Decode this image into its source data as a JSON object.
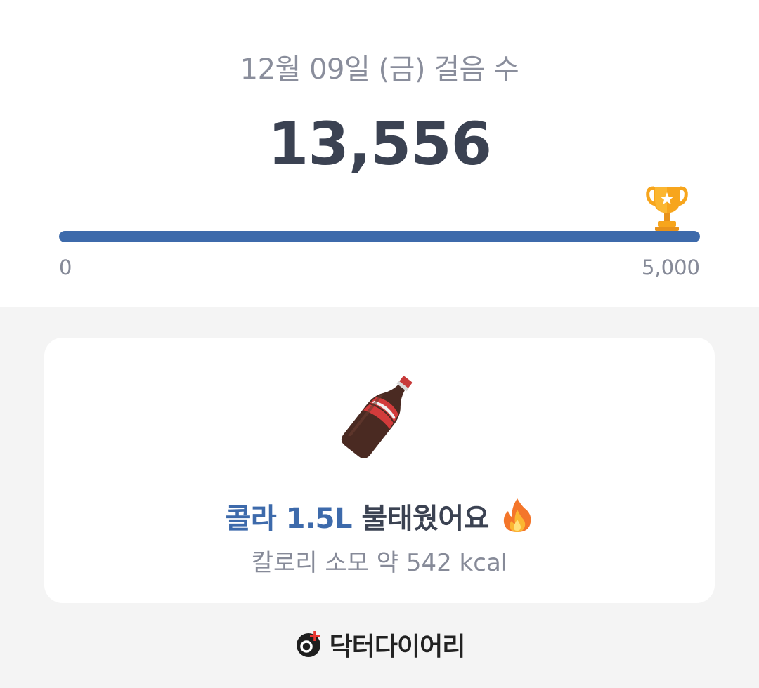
{
  "header": {
    "date_label": "12월 09일 (금) 걸음 수",
    "step_count": "13,556"
  },
  "progress": {
    "min_label": "0",
    "max_label": "5,000",
    "fill_fraction": 1.0,
    "goal_icon": "trophy-icon"
  },
  "card": {
    "item_icon": "cola-bottle-icon",
    "food_text": "콜라 1.5L",
    "burn_text": " 불태웠어요",
    "burn_icon": "fire-icon",
    "kcal_text": "칼로리 소모 약 542 kcal"
  },
  "footer": {
    "brand_name": "닥터다이어리",
    "brand_icon": "doctor-diary-logo"
  },
  "colors": {
    "accent": "#3d6aab",
    "text_primary": "#3b4252",
    "text_secondary": "#868a98",
    "background": "#f4f4f4"
  }
}
